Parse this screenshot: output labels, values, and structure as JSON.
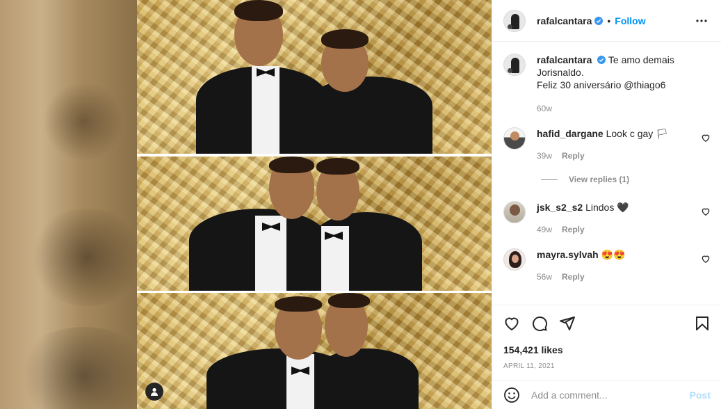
{
  "header": {
    "username": "rafalcantara",
    "separator": "•",
    "follow_label": "Follow"
  },
  "caption": {
    "username": "rafalcantara",
    "line1": "Te amo demais",
    "line2": "Jorisnaldo.",
    "line3": "Feliz 30 aniversário @thiago6",
    "time": "60w"
  },
  "comments": [
    {
      "username": "hafid_dargane",
      "text": "Look c gay 🏳",
      "time": "39w",
      "reply_label": "Reply"
    },
    {
      "username": "jsk_s2_s2",
      "text": "Lindos 🖤",
      "time": "49w",
      "reply_label": "Reply"
    },
    {
      "username": "mayra.sylvah",
      "text": "😍😍",
      "time": "56w",
      "reply_label": "Reply"
    }
  ],
  "view_replies": "View replies (1)",
  "likes": "154,421 likes",
  "date": "APRIL 11, 2021",
  "add_comment": {
    "placeholder": "Add a comment...",
    "post_label": "Post"
  },
  "colors": {
    "accent": "#0095f6",
    "post_disabled": "#b2dffc",
    "muted": "#8e8e8e",
    "text": "#262626"
  },
  "icons": [
    "user-tag-icon",
    "verified-icon",
    "more-options-icon",
    "heart-icon",
    "comment-icon",
    "share-icon",
    "save-icon",
    "emoji-icon"
  ]
}
